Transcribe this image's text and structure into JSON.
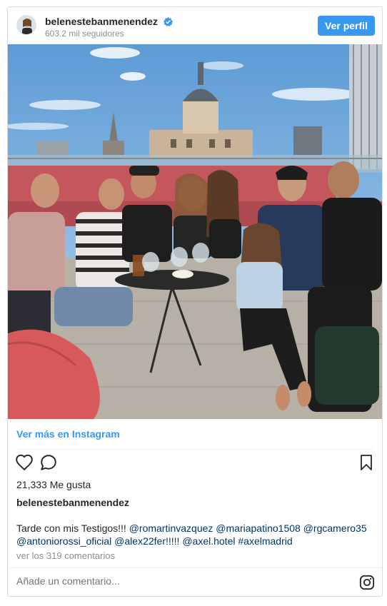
{
  "header": {
    "username": "belenestebanmenendez",
    "followers": "603.2 mil seguidores",
    "profile_button": "Ver perfil"
  },
  "post": {
    "see_more": "Ver más en Instagram",
    "likes": "21,333 Me gusta",
    "username": "belenestebanmenendez",
    "caption_text": "Tarde con mis Testigos!!!",
    "mentions": [
      "@romartinvazquez",
      "@mariapatino1508",
      "@rgcamero35",
      "@antoniorossi_oficial",
      "@alex22fer!!!!!",
      "@axel.hotel",
      "#axelmadrid"
    ],
    "comments_link": "ver los 319 comentarios",
    "comment_placeholder": "Añade un comentario..."
  },
  "colors": {
    "primary_blue": "#3897f0",
    "mention_blue": "#003569",
    "muted_gray": "#8e8e8e"
  },
  "icons": [
    "verified-badge-icon",
    "heart-icon",
    "comment-icon",
    "bookmark-icon",
    "instagram-icon"
  ]
}
